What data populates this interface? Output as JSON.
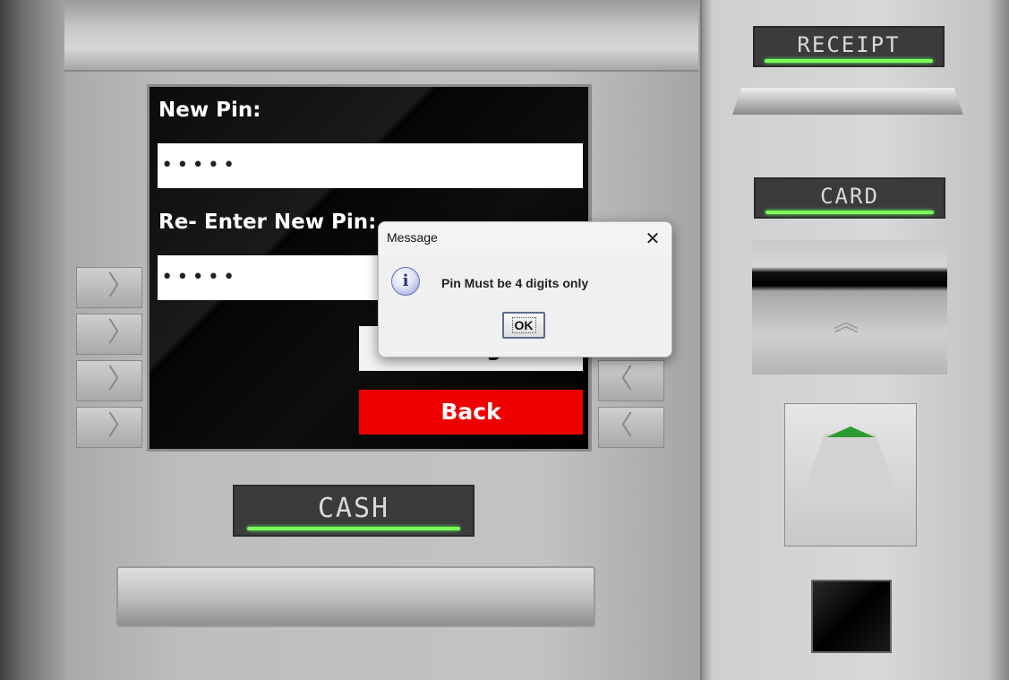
{
  "screen": {
    "new_pin_label": "New Pin:",
    "new_pin_value": "•••••",
    "reenter_pin_label": "Re- Enter New Pin:",
    "reenter_pin_value": "•••••",
    "change_button": "Change",
    "back_button": "Back"
  },
  "hardware": {
    "receipt_label": "RECEIPT",
    "card_label": "CARD",
    "cash_label": "CASH",
    "left_side_button_glyph": "〉",
    "right_side_button_glyph": "〈",
    "card_arrow_glyph": "︽"
  },
  "dialog": {
    "title": "Message",
    "close_glyph": "✕",
    "icon_glyph": "i",
    "message": "Pin Must be 4 digits only",
    "ok_label": "OK"
  },
  "colors": {
    "back_button": "#ee0000",
    "led": "#7dff5a",
    "keypad_indicator": "#2e9b2e"
  }
}
